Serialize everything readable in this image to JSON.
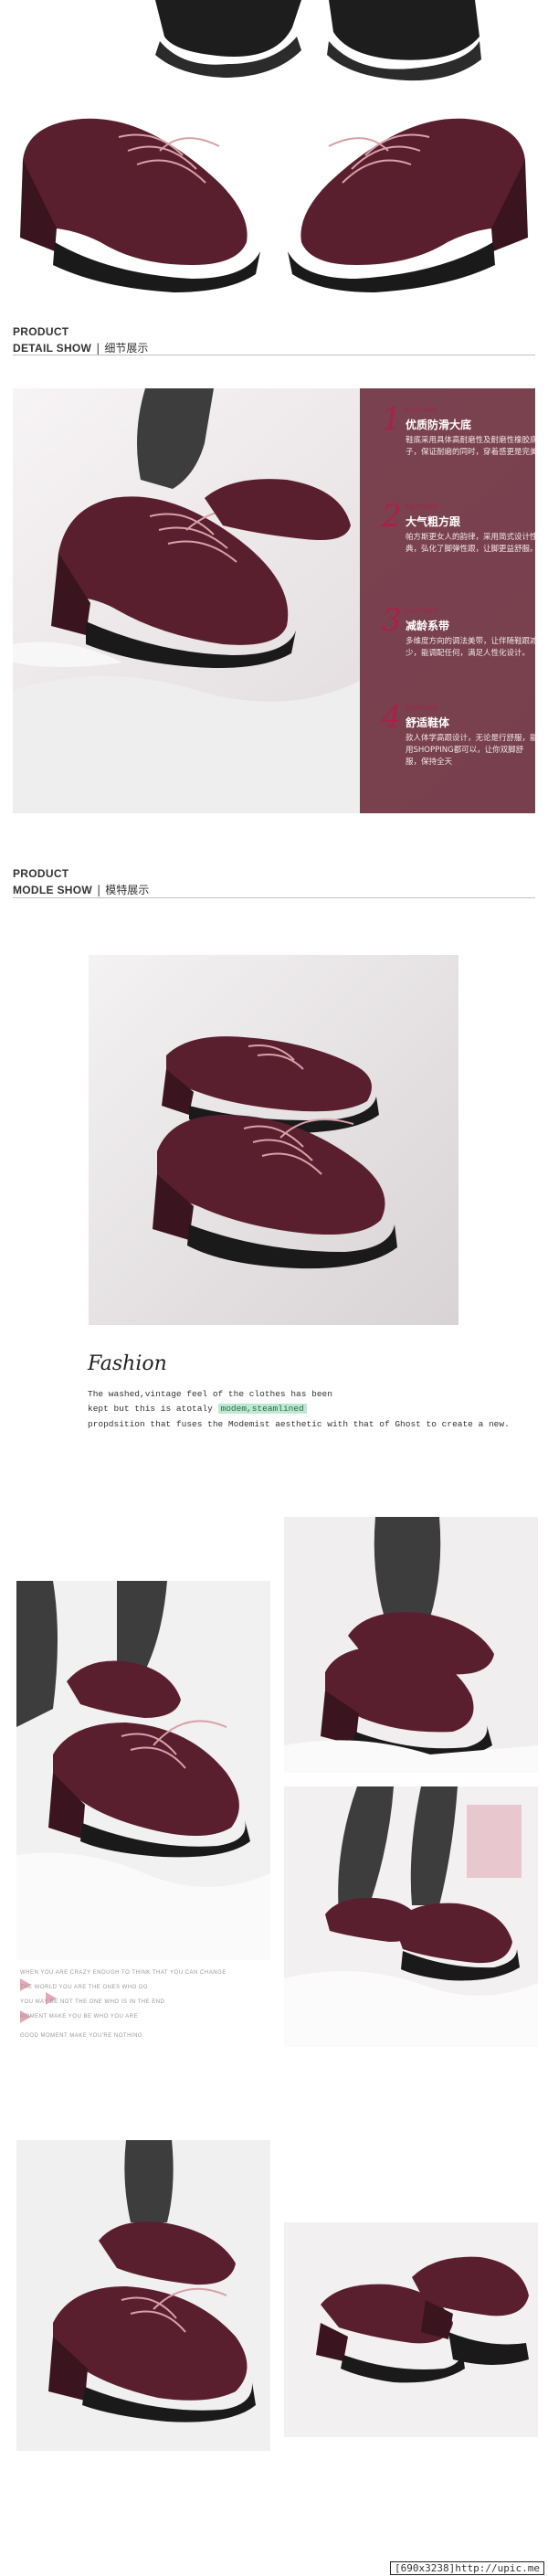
{
  "detail_section": {
    "en_line1": "PRODUCT",
    "en_line2": "DETAIL SHOW",
    "divider": "|",
    "cn": "细节展示"
  },
  "features": [
    {
      "num": "1",
      "tag": "FEATURE",
      "title": "优质防滑大底",
      "desc": "鞋底采用具体高耐磨性及耐磨性橡胶底子，保证耐磨的同时，穿着感更是完美"
    },
    {
      "num": "2",
      "tag": "FEATURE",
      "title": "大气粗方跟",
      "desc": "帕方斯更女人的韵律，采用简式设计性典，弘化了脚弹性跟，让脚更益舒服。"
    },
    {
      "num": "3",
      "tag": "FEATURE",
      "title": "减龄系带",
      "desc": "多维度方向的调法美带，让伴随鞋跟减少，能调配任何，满足人性化设计。"
    },
    {
      "num": "4",
      "tag": "FEATURE",
      "title": "舒适鞋体",
      "desc": "款人体学高跟设计，无论是行舒服，能用SHOPPING都可以，让你双脚舒服，保持全天"
    }
  ],
  "model_section": {
    "en_line1": "PRODUCT",
    "en_line2": "MODLE SHOW",
    "divider": "|",
    "cn": "模特展示"
  },
  "fashion": {
    "title": "Fashion",
    "line1": "The washed,vintage feel of the clothes has been",
    "line2_pre": "kept but this is atotaly ",
    "line2_hl": "modem,steamlined",
    "line3": "propdsition that fuses the Modemist aesthetic with that of Ghost to create a new."
  },
  "watermark_lines": [
    "WHEN YOU ARE CRAZY ENOUGH TO THINK THAT YOU CAN CHANGE",
    "THE WORLD YOU ARE THE ONES WHO DO",
    "YOU MAY BE NOT THE ONE WHO IS IN THE END",
    "MOMENT MAKE YOU BE WHO YOU ARE",
    "GOOD MOMENT MAKE YOU'RE NOTHING"
  ],
  "footer": {
    "text": "[690x3238]http://upic.me"
  },
  "colors": {
    "shoe": "#5a1f2e",
    "accent": "#a8214a",
    "highlight": "#bfe8d2"
  }
}
